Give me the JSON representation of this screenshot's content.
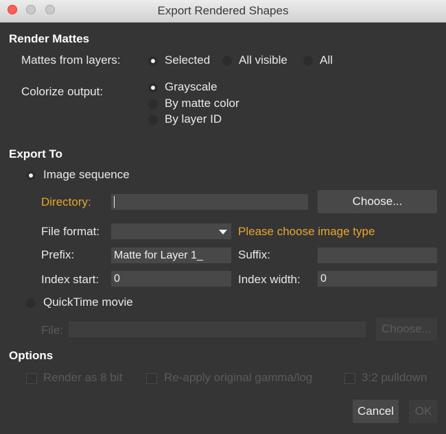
{
  "window": {
    "title": "Export Rendered Shapes"
  },
  "render_mattes": {
    "heading": "Render Mattes",
    "mattes_label": "Mattes from layers:",
    "mattes_options": [
      {
        "label": "Selected",
        "selected": true
      },
      {
        "label": "All visible",
        "selected": false
      },
      {
        "label": "All",
        "selected": false
      }
    ],
    "colorize_label": "Colorize output:",
    "colorize_options": [
      {
        "label": "Grayscale",
        "selected": true
      },
      {
        "label": "By matte color",
        "selected": false
      },
      {
        "label": "By layer ID",
        "selected": false
      }
    ]
  },
  "export_to": {
    "heading": "Export To",
    "image_sequence": {
      "label": "Image sequence",
      "selected": true,
      "directory_label": "Directory:",
      "directory_value": "",
      "choose_label": "Choose...",
      "file_format_label": "File format:",
      "file_format_value": "",
      "file_format_warning": "Please choose image type",
      "prefix_label": "Prefix:",
      "prefix_value": "Matte for Layer 1_",
      "suffix_label": "Suffix:",
      "suffix_value": "",
      "index_start_label": "Index start:",
      "index_start_value": "0",
      "index_width_label": "Index width:",
      "index_width_value": "0"
    },
    "quicktime": {
      "label": "QuickTime movie",
      "selected": false,
      "file_label": "File:",
      "file_value": "",
      "choose_label": "Choose..."
    }
  },
  "options": {
    "heading": "Options",
    "render_8bit": "Render as 8 bit",
    "reapply_gamma": "Re-apply original gamma/log",
    "pulldown": "3:2 pulldown"
  },
  "buttons": {
    "cancel": "Cancel",
    "ok": "OK"
  }
}
